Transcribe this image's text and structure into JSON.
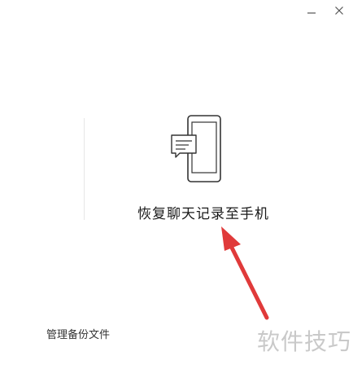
{
  "window": {
    "controls": {
      "minimize_icon": "minimize-icon",
      "close_icon": "close-icon"
    }
  },
  "main": {
    "illustration_icon": "phone-chat-icon",
    "restore_label": "恢复聊天记录至手机",
    "manage_label": "管理备份文件"
  },
  "annotation": {
    "arrow_color": "#e03a3a"
  },
  "watermark": {
    "text": "软件技巧"
  }
}
